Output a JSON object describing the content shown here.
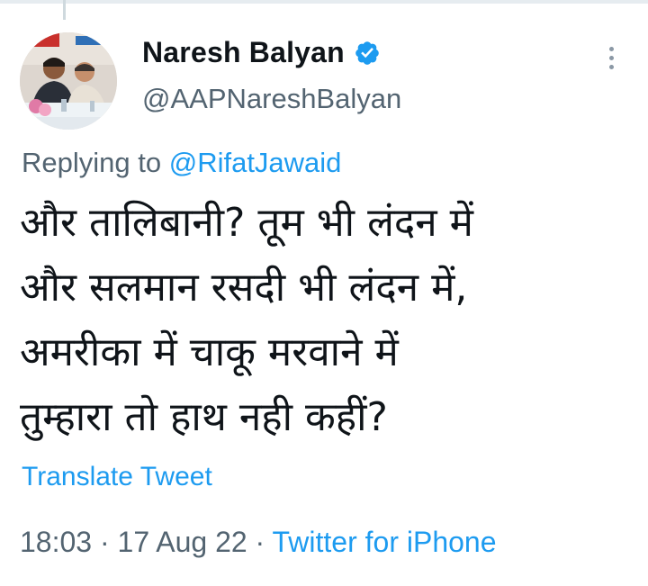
{
  "author": {
    "name": "Naresh Balyan",
    "handle": "@AAPNareshBalyan",
    "verified": true,
    "avatar_icon": "profile-photo-two-men-seated"
  },
  "reply": {
    "prefix": "Replying to",
    "mention": "@RifatJawaid"
  },
  "tweet": {
    "lines": [
      "और तालिबानी? तूम भी लंदन में",
      "और सलमान रसदी भी लंदन में,",
      "अमरीका में चाकू मरवाने में",
      "तुम्हारा तो हाथ नही कहीं?"
    ],
    "translate_label": "Translate Tweet"
  },
  "meta": {
    "time": "18:03",
    "separator": "·",
    "date": "17 Aug 22",
    "source": "Twitter for iPhone"
  },
  "colors": {
    "accent": "#1d9bf0",
    "secondary_text": "#536471",
    "primary_text": "#0f1419"
  },
  "icons": {
    "verified": "verified-badge-icon",
    "more": "more-options-icon"
  }
}
